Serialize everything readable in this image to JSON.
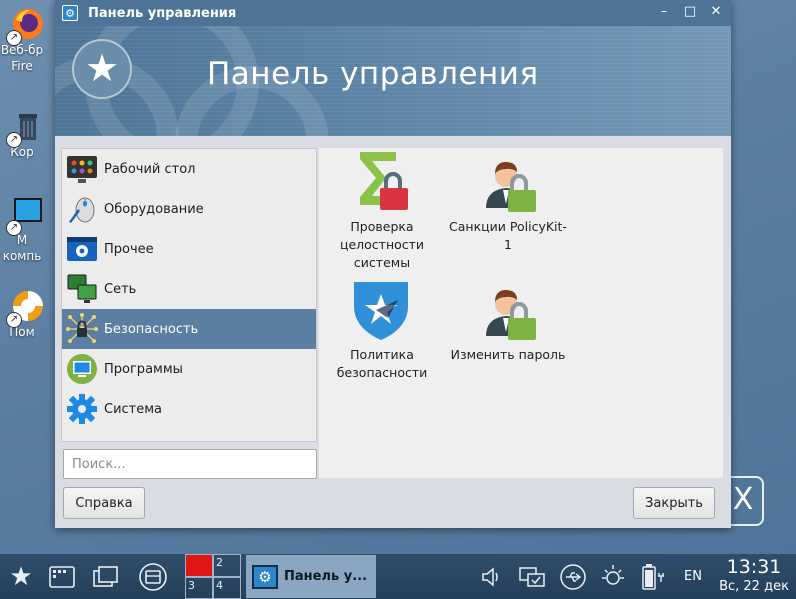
{
  "desktop": {
    "icons": [
      {
        "label": "Веб-бр",
        "label2": "Fire",
        "icon": "firefox-icon"
      },
      {
        "label": "Кор",
        "icon": "trash-icon"
      },
      {
        "label": "М",
        "label2": "компь",
        "icon": "computer-icon"
      },
      {
        "label": "Пом",
        "icon": "help-lifebuoy-icon"
      }
    ],
    "wallpaper_logo": "X"
  },
  "window": {
    "title": "Панель управления",
    "banner_title": "Панель управления",
    "controls": {
      "minimize": "–",
      "maximize": "□",
      "close": "✕"
    }
  },
  "sidebar": {
    "items": [
      {
        "label": "Рабочий стол",
        "icon": "desktop-icon",
        "active": false
      },
      {
        "label": "Оборудование",
        "icon": "hardware-mouse-icon",
        "active": false
      },
      {
        "label": "Прочее",
        "icon": "other-settings-icon",
        "active": false
      },
      {
        "label": "Сеть",
        "icon": "network-icon",
        "active": false
      },
      {
        "label": "Безопасность",
        "icon": "security-icon",
        "active": true
      },
      {
        "label": "Программы",
        "icon": "programs-icon",
        "active": false
      },
      {
        "label": "Система",
        "icon": "system-gear-icon",
        "active": false
      }
    ]
  },
  "applets": [
    {
      "label_lines": [
        "Проверка",
        "целостности",
        "системы"
      ],
      "icon": "integrity-check-icon"
    },
    {
      "label_lines": [
        "Санкции PolicyKit-1"
      ],
      "icon": "policykit-user-lock-icon"
    },
    {
      "label_lines": [
        "Политика",
        "безопасности"
      ],
      "icon": "security-policy-shield-icon"
    },
    {
      "label_lines": [
        "Изменить пароль"
      ],
      "icon": "change-password-user-lock-icon"
    }
  ],
  "search": {
    "placeholder": "Поиск...",
    "value": ""
  },
  "buttons": {
    "help": "Справка",
    "close": "Закрыть"
  },
  "taskbar": {
    "pager": [
      "1",
      "2",
      "3",
      "4"
    ],
    "task_label": "Панель у...",
    "language": "EN",
    "time": "13:31",
    "date": "Вс, 22 дек"
  },
  "colors": {
    "accent": "#5a7fa3",
    "titlebar": "#4d7496",
    "taskbar": "#2a4763",
    "pager_active": "#e01515",
    "lock_green": "#7cb342",
    "lock_red": "#d9343f"
  }
}
